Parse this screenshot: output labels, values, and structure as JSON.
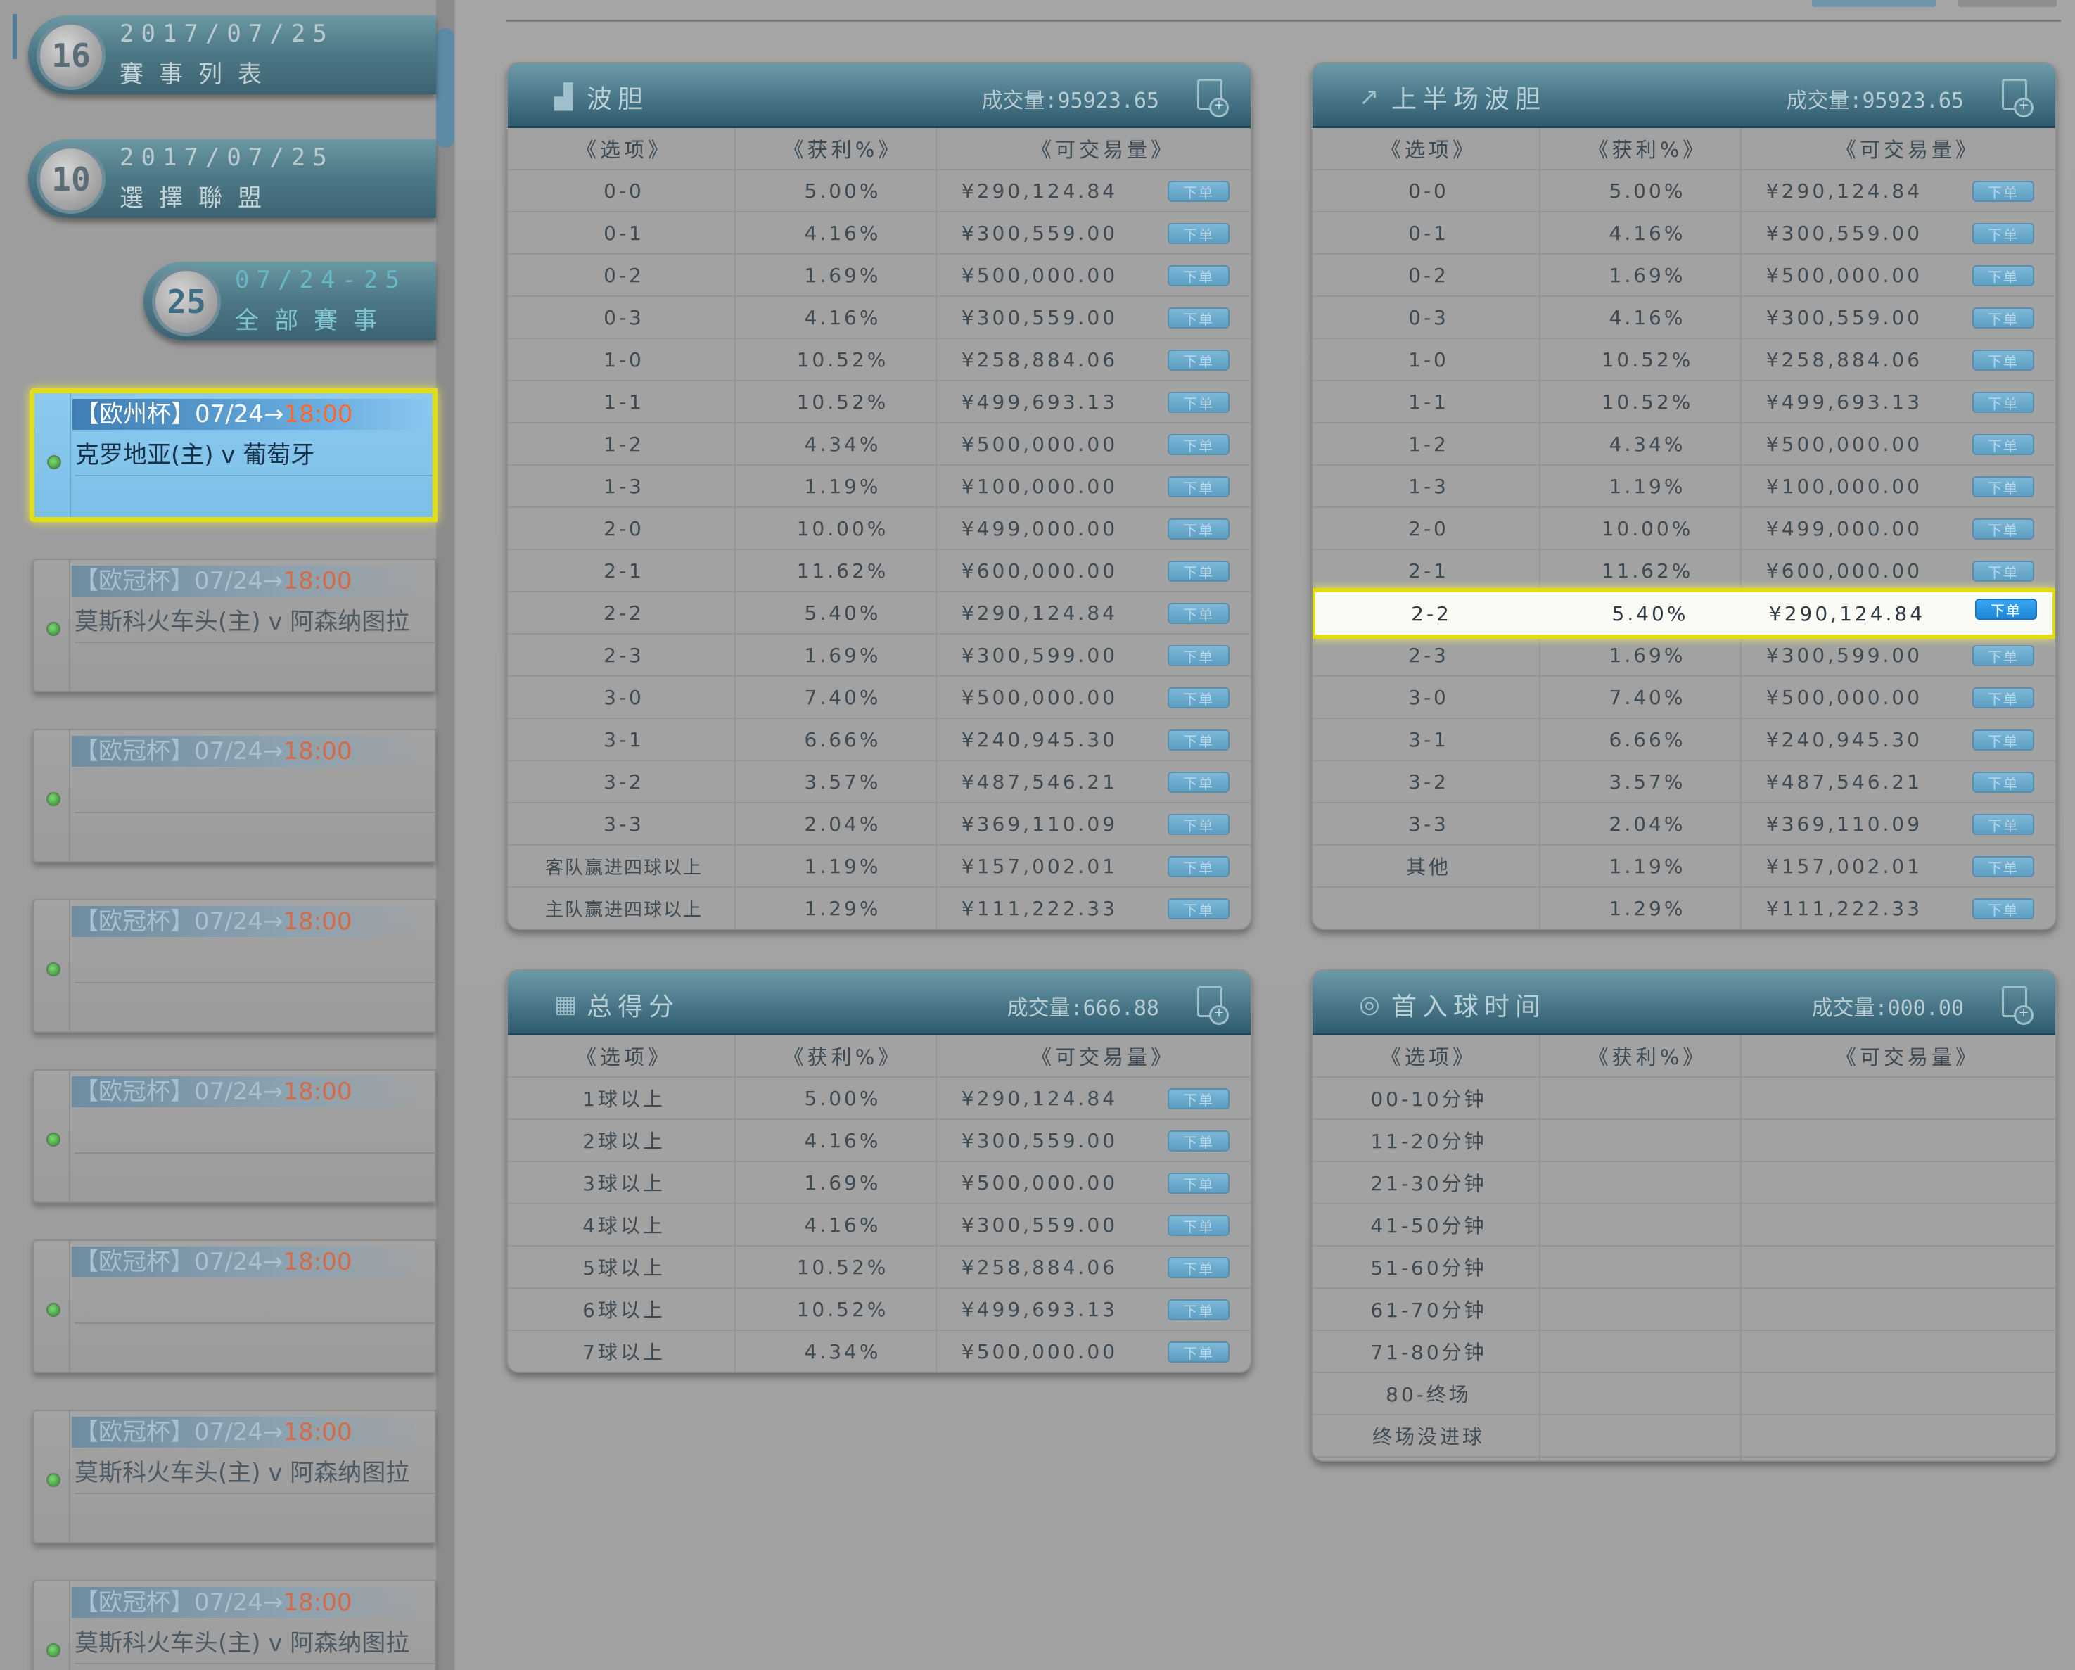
{
  "sidebar": {
    "date_cards": [
      {
        "number": "16",
        "line1": "2017/07/25",
        "line2": "賽事列表"
      },
      {
        "number": "10",
        "line1": "2017/07/25",
        "line2": "選擇聯盟"
      },
      {
        "number": "25",
        "line1": "07/24-25",
        "line2": "全部賽事"
      }
    ],
    "matches": [
      {
        "league": "【欧州杯】07/24",
        "arrow": "→",
        "time": "18:00",
        "teams": "克罗地亚(主) v 葡萄牙",
        "active": true
      },
      {
        "league": "【欧冠杯】07/24",
        "arrow": "→",
        "time": "18:00",
        "teams": "莫斯科火车头(主) v 阿森纳图拉",
        "active": false
      },
      {
        "league": "【欧冠杯】07/24",
        "arrow": "→",
        "time": "18:00",
        "teams": "",
        "active": false
      },
      {
        "league": "【欧冠杯】07/24",
        "arrow": "→",
        "time": "18:00",
        "teams": "",
        "active": false
      },
      {
        "league": "【欧冠杯】07/24",
        "arrow": "→",
        "time": "18:00",
        "teams": "",
        "active": false
      },
      {
        "league": "【欧冠杯】07/24",
        "arrow": "→",
        "time": "18:00",
        "teams": "",
        "active": false
      },
      {
        "league": "【欧冠杯】07/24",
        "arrow": "→",
        "time": "18:00",
        "teams": "莫斯科火车头(主) v 阿森纳图拉",
        "active": false
      },
      {
        "league": "【欧冠杯】07/24",
        "arrow": "→",
        "time": "18:00",
        "teams": "莫斯科火车头(主) v 阿森纳图拉",
        "active": false
      }
    ]
  },
  "order_label": "下单",
  "headers": {
    "option": "《选项》",
    "profit": "《获利%》",
    "tradable": "《可交易量》"
  },
  "panels": {
    "correct_score": {
      "icon": "bar-chart-icon",
      "title": "波胆",
      "volume": "成交量:95923.65",
      "rows": [
        [
          "0-0",
          "5.00%",
          "¥290,124.84"
        ],
        [
          "0-1",
          "4.16%",
          "¥300,559.00"
        ],
        [
          "0-2",
          "1.69%",
          "¥500,000.00"
        ],
        [
          "0-3",
          "4.16%",
          "¥300,559.00"
        ],
        [
          "1-0",
          "10.52%",
          "¥258,884.06"
        ],
        [
          "1-1",
          "10.52%",
          "¥499,693.13"
        ],
        [
          "1-2",
          "4.34%",
          "¥500,000.00"
        ],
        [
          "1-3",
          "1.19%",
          "¥100,000.00"
        ],
        [
          "2-0",
          "10.00%",
          "¥499,000.00"
        ],
        [
          "2-1",
          "11.62%",
          "¥600,000.00"
        ],
        [
          "2-2",
          "5.40%",
          "¥290,124.84"
        ],
        [
          "2-3",
          "1.69%",
          "¥300,599.00"
        ],
        [
          "3-0",
          "7.40%",
          "¥500,000.00"
        ],
        [
          "3-1",
          "6.66%",
          "¥240,945.30"
        ],
        [
          "3-2",
          "3.57%",
          "¥487,546.21"
        ],
        [
          "3-3",
          "2.04%",
          "¥369,110.09"
        ],
        [
          "客队赢进四球以上",
          "1.19%",
          "¥157,002.01"
        ],
        [
          "主队赢进四球以上",
          "1.29%",
          "¥111,222.33"
        ]
      ]
    },
    "half_score": {
      "icon": "trend-line-icon",
      "title": "上半场波胆",
      "volume": "成交量:95923.65",
      "highlight_row": 10,
      "rows": [
        [
          "0-0",
          "5.00%",
          "¥290,124.84"
        ],
        [
          "0-1",
          "4.16%",
          "¥300,559.00"
        ],
        [
          "0-2",
          "1.69%",
          "¥500,000.00"
        ],
        [
          "0-3",
          "4.16%",
          "¥300,559.00"
        ],
        [
          "1-0",
          "10.52%",
          "¥258,884.06"
        ],
        [
          "1-1",
          "10.52%",
          "¥499,693.13"
        ],
        [
          "1-2",
          "4.34%",
          "¥500,000.00"
        ],
        [
          "1-3",
          "1.19%",
          "¥100,000.00"
        ],
        [
          "2-0",
          "10.00%",
          "¥499,000.00"
        ],
        [
          "2-1",
          "11.62%",
          "¥600,000.00"
        ],
        [
          "2-2",
          "5.40%",
          "¥290,124.84"
        ],
        [
          "2-3",
          "1.69%",
          "¥300,599.00"
        ],
        [
          "3-0",
          "7.40%",
          "¥500,000.00"
        ],
        [
          "3-1",
          "6.66%",
          "¥240,945.30"
        ],
        [
          "3-2",
          "3.57%",
          "¥487,546.21"
        ],
        [
          "3-3",
          "2.04%",
          "¥369,110.09"
        ],
        [
          "其他",
          "1.19%",
          "¥157,002.01"
        ],
        [
          "",
          "1.29%",
          "¥111,222.33"
        ]
      ]
    },
    "total_goals": {
      "icon": "calendar-icon",
      "title": "总得分",
      "volume": "成交量:666.88",
      "rows": [
        [
          "1球以上",
          "5.00%",
          "¥290,124.84"
        ],
        [
          "2球以上",
          "4.16%",
          "¥300,559.00"
        ],
        [
          "3球以上",
          "1.69%",
          "¥500,000.00"
        ],
        [
          "4球以上",
          "4.16%",
          "¥300,559.00"
        ],
        [
          "5球以上",
          "10.52%",
          "¥258,884.06"
        ],
        [
          "6球以上",
          "10.52%",
          "¥499,693.13"
        ],
        [
          "7球以上",
          "4.34%",
          "¥500,000.00"
        ]
      ]
    },
    "first_goal": {
      "icon": "target-icon",
      "title": "首入球时间",
      "volume": "成交量:000.00",
      "rows": [
        [
          "00-10分钟",
          "",
          ""
        ],
        [
          "11-20分钟",
          "",
          ""
        ],
        [
          "21-30分钟",
          "",
          ""
        ],
        [
          "41-50分钟",
          "",
          ""
        ],
        [
          "51-60分钟",
          "",
          ""
        ],
        [
          "61-70分钟",
          "",
          ""
        ],
        [
          "71-80分钟",
          "",
          ""
        ],
        [
          "80-终场",
          "",
          ""
        ],
        [
          "终场没进球",
          "",
          ""
        ]
      ]
    }
  },
  "colors": {
    "accent": "#2f5a6d",
    "highlight": "#e1db19",
    "time_text": "#d66a47",
    "order_button": "#5d9fc4"
  }
}
